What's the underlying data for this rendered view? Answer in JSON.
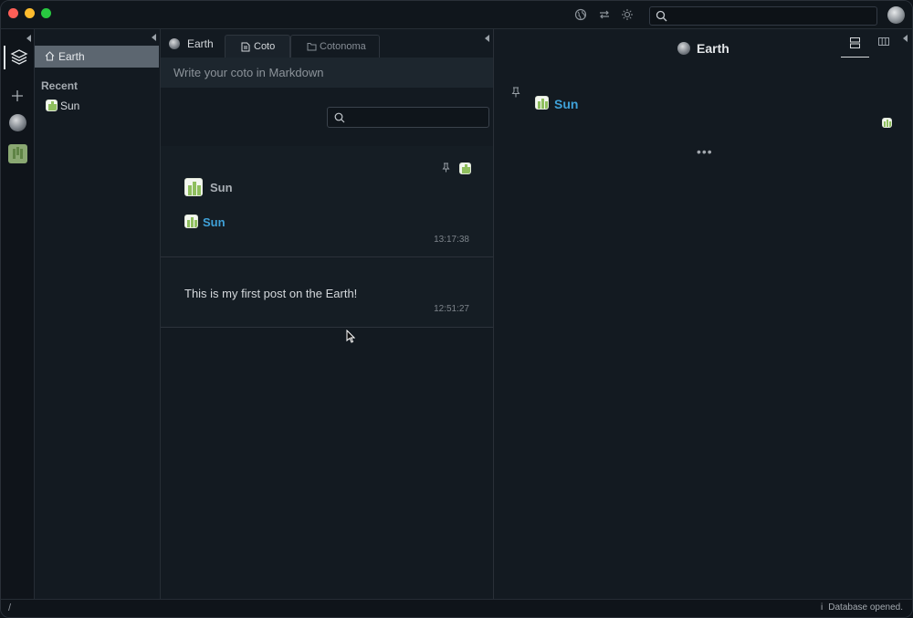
{
  "titlebar": {
    "search_placeholder": ""
  },
  "nav": {
    "current": "Earth",
    "recent_heading": "Recent",
    "recent_items": [
      {
        "label": "Sun"
      }
    ]
  },
  "middle": {
    "home_label": "Earth",
    "tabs": [
      {
        "label": "Coto",
        "active": true
      },
      {
        "label": "Cotonoma",
        "active": false
      }
    ],
    "composer_placeholder": "Write your coto in Markdown",
    "search_placeholder": "",
    "cotos": [
      {
        "cotonoma_name": "Sun",
        "link_label": "Sun",
        "time": "13:17:38"
      },
      {
        "text": "This is my first post on the Earth!",
        "time": "12:51:27"
      }
    ]
  },
  "right": {
    "title": "Earth",
    "pinned_label": "Sun",
    "more": "•••"
  },
  "status": {
    "path": "/",
    "info_icon": "i",
    "message": "Database opened."
  },
  "colors": {
    "accent_link": "#3fa1d8",
    "background": "#131a21",
    "sun_icon_green": "#8fbf5e"
  }
}
